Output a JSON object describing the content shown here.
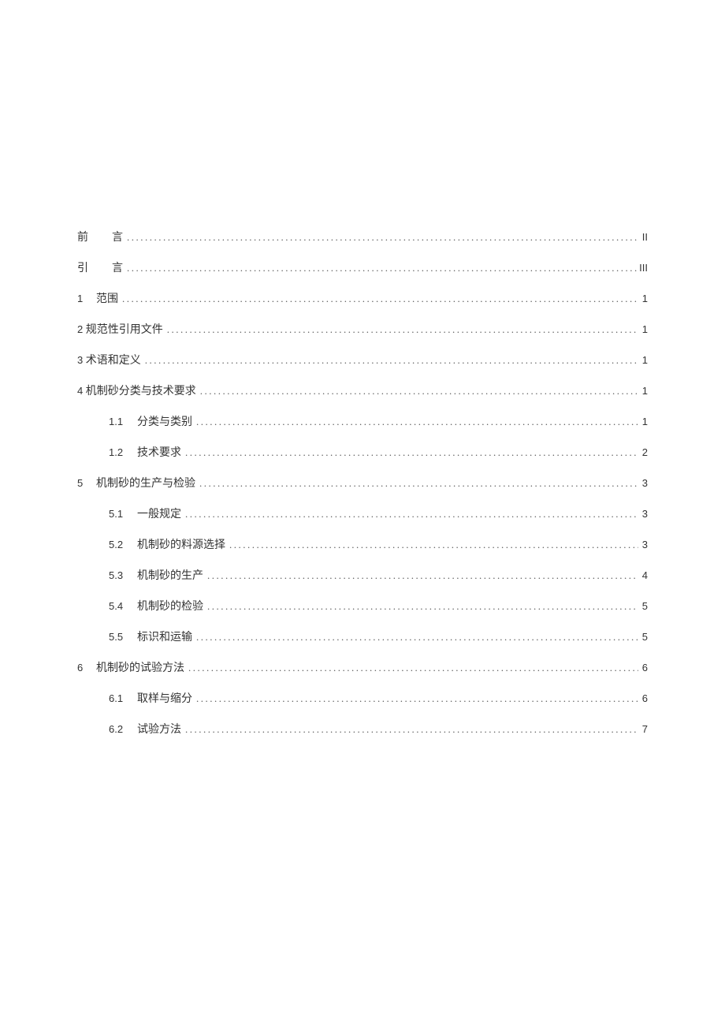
{
  "toc": {
    "entries": [
      {
        "level": 0,
        "num": "前",
        "title": "言",
        "page": "II",
        "wide_num": true,
        "spaced": false
      },
      {
        "level": 0,
        "num": "引",
        "title": "言",
        "page": "III",
        "wide_num": true,
        "spaced": false
      },
      {
        "level": 0,
        "num": "1",
        "title": "范围",
        "page": "1",
        "chap": true
      },
      {
        "level": 0,
        "num": "2",
        "title": "规范性引用文件",
        "page": "1",
        "tight": true
      },
      {
        "level": 0,
        "num": "3",
        "title": "术语和定义",
        "page": "1",
        "tight": true
      },
      {
        "level": 0,
        "num": "4",
        "title": "机制砂分类与技术要求",
        "page": "1",
        "tight": true
      },
      {
        "level": 1,
        "num": "1.1",
        "title": "分类与类别",
        "page": "1"
      },
      {
        "level": 1,
        "num": "1.2",
        "title": "技术要求",
        "page": "2"
      },
      {
        "level": 0,
        "num": "5",
        "title": "机制砂的生产与检验",
        "page": "3",
        "chap": true
      },
      {
        "level": 1,
        "num": "5.1",
        "title": "一般规定",
        "page": "3"
      },
      {
        "level": 1,
        "num": "5.2",
        "title": "机制砂的料源选择",
        "page": "3"
      },
      {
        "level": 1,
        "num": "5.3",
        "title": "机制砂的生产",
        "page": "4"
      },
      {
        "level": 1,
        "num": "5.4",
        "title": "机制砂的检验",
        "page": "5"
      },
      {
        "level": 1,
        "num": "5.5",
        "title": "标识和运输",
        "page": "5"
      },
      {
        "level": 0,
        "num": "6",
        "title": "机制砂的试验方法",
        "page": "6",
        "chap": true
      },
      {
        "level": 1,
        "num": "6.1",
        "title": "取样与缩分",
        "page": "6"
      },
      {
        "level": 1,
        "num": "6.2",
        "title": "试验方法",
        "page": "7"
      }
    ]
  }
}
